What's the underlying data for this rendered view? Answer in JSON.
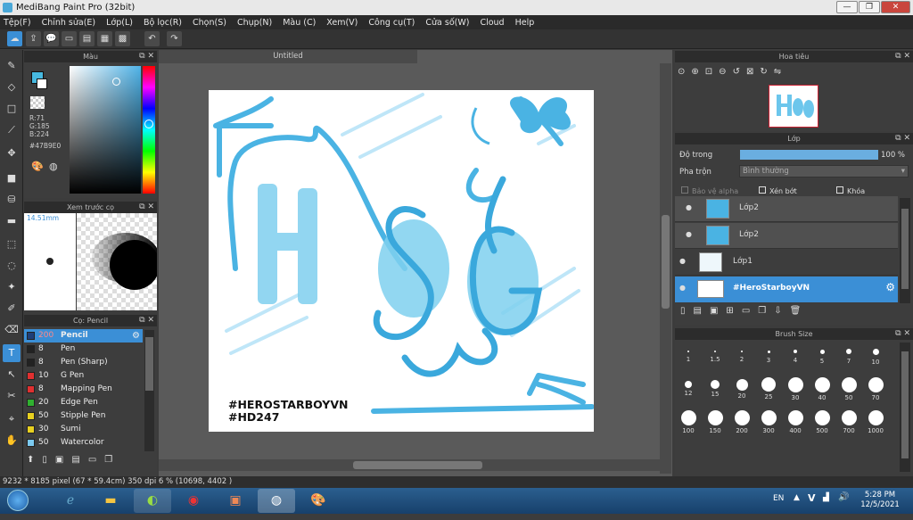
{
  "window": {
    "title": "MediBang Paint Pro (32bit)"
  },
  "menu": [
    "Tệp(F)",
    "Chỉnh sửa(E)",
    "Lớp(L)",
    "Bộ lọc(R)",
    "Chọn(S)",
    "Chụp(N)",
    "Màu (C)",
    "Xem(V)",
    "Công cụ(T)",
    "Cửa số(W)",
    "Cloud",
    "Help"
  ],
  "color_panel": {
    "title": "Màu",
    "r": "R:71",
    "g": "G:185",
    "b": "B:224",
    "hex": "#47B9E0",
    "current_color": "#47B9E0"
  },
  "brush_preview": {
    "title": "Xem trước cọ",
    "size": "14.51mm"
  },
  "brush_list": {
    "title": "Cọ: Pencil",
    "items": [
      {
        "size": "200",
        "name": "Pencil",
        "color": "#1e3f78"
      },
      {
        "size": "8",
        "name": "Pen",
        "color": "#222222"
      },
      {
        "size": "8",
        "name": "Pen (Sharp)",
        "color": "#222222"
      },
      {
        "size": "10",
        "name": "G Pen",
        "color": "#e03030"
      },
      {
        "size": "8",
        "name": "Mapping Pen",
        "color": "#e03030"
      },
      {
        "size": "20",
        "name": "Edge Pen",
        "color": "#30b030"
      },
      {
        "size": "50",
        "name": "Stipple Pen",
        "color": "#e8d020"
      },
      {
        "size": "30",
        "name": "Sumi",
        "color": "#e8d020"
      },
      {
        "size": "50",
        "name": "Watercolor",
        "color": "#7ccaf0"
      }
    ]
  },
  "document": {
    "tab": "Untitled",
    "text_line1": "#HEROSTARBOYVN",
    "text_line2": "#HD247"
  },
  "navigator": {
    "title": "Hoa tiêu"
  },
  "layers": {
    "title": "Lớp",
    "opacity_label": "Độ trong",
    "opacity_value": "100 %",
    "opacity": 1.0,
    "blend_label": "Pha trộn",
    "blend_value": "Bình thường",
    "protect_alpha": "Bảo vệ alpha",
    "clipping": "Xén bớt",
    "lock": "Khóa",
    "items": [
      {
        "name": "Lớp2"
      },
      {
        "name": "Lớp2"
      },
      {
        "name": "Lớp1"
      },
      {
        "name": "#HeroStarboyVN",
        "selected": true
      }
    ]
  },
  "brush_size": {
    "title": "Brush Size",
    "sizes": [
      "1",
      "1.5",
      "2",
      "3",
      "4",
      "5",
      "7",
      "10",
      "12",
      "15",
      "20",
      "25",
      "30",
      "40",
      "50",
      "70",
      "100",
      "150",
      "200",
      "300",
      "400",
      "500",
      "700",
      "1000"
    ]
  },
  "status": {
    "text": "9232 * 8185 pixel   (67 * 59.4cm)   350 dpi   6 %   (10698, 4402 )"
  },
  "taskbar": {
    "lang": "EN",
    "time": "5:28 PM",
    "date": "12/5/2021"
  }
}
